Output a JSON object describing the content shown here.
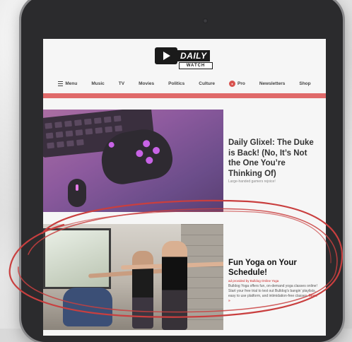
{
  "site": {
    "logo_word": "DAILY",
    "logo_sub": "WATCH"
  },
  "nav": [
    {
      "label": "Menu"
    },
    {
      "label": "Music"
    },
    {
      "label": "TV"
    },
    {
      "label": "Movies"
    },
    {
      "label": "Politics"
    },
    {
      "label": "Culture"
    },
    {
      "label": "Pro"
    },
    {
      "label": "Newsletters"
    },
    {
      "label": "Shop"
    }
  ],
  "articles": [
    {
      "title": "Daily Glixel: The Duke is Back! (No, It’s Not the One You’re Thinking Of)",
      "subtitle": "Large-handed gamers rejoice!"
    },
    {
      "title": "Fun Yoga on Your Schedule!",
      "sponsor": "ad provided by Bulldog Online Yoga",
      "body": "Bulldog Yoga offers fun, on-demand yoga classes online! Start your free trial to test out Bulldog’s bangin’ playlists, easy to use platform, and intimidation-free classes.",
      "more": "More »"
    }
  ],
  "colors": {
    "accent": "#e06a6a",
    "highlight_loop": "#c93f3f",
    "bezel": "#2b2b2d"
  }
}
